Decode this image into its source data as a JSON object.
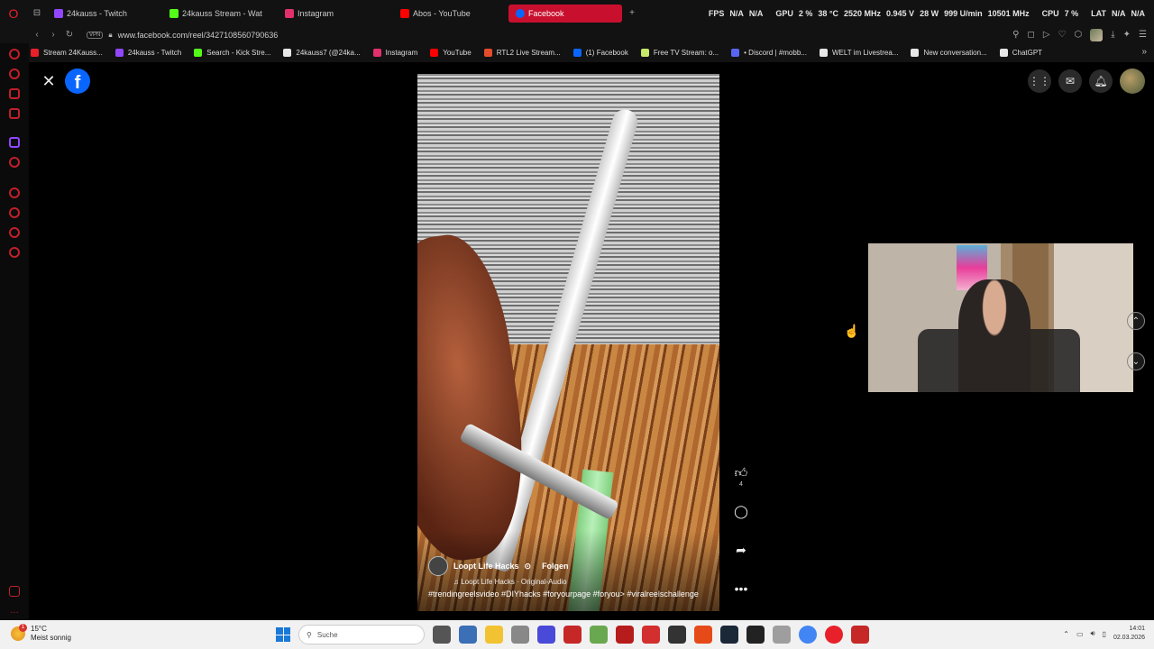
{
  "tabs": [
    {
      "label": "24kauss - Twitch",
      "color": "#9146ff"
    },
    {
      "label": "24kauss Stream - Wat",
      "color": "#53fc18"
    },
    {
      "label": "Instagram",
      "color": "#e1306c"
    },
    {
      "label": "Abos - YouTube",
      "color": "#ff0000"
    },
    {
      "label": "Facebook",
      "color": "#0866ff",
      "active": true
    }
  ],
  "stats": {
    "fps_label": "FPS",
    "fps_a": "N/A",
    "fps_b": "N/A",
    "gpu_label": "GPU",
    "gpu_pct": "2 %",
    "gpu_temp": "38 °C",
    "gpu_clock": "2520 MHz",
    "gpu_volt": "0.945 V",
    "gpu_watt": "28 W",
    "gpu_fan": "999 U/min",
    "gpu_mem": "10501 MHz",
    "cpu_label": "CPU",
    "cpu_pct": "7 %",
    "lat_label": "LAT",
    "lat_a": "N/A",
    "lat_b": "N/A"
  },
  "address": {
    "vpn": "VPN",
    "url": "www.facebook.com/reel/3427108560790636"
  },
  "bookmarks": [
    {
      "label": "Stream 24Kauss...",
      "color": "#e8202a"
    },
    {
      "label": "24kauss - Twitch",
      "color": "#9146ff"
    },
    {
      "label": "Search - Kick Stre...",
      "color": "#53fc18"
    },
    {
      "label": "24kauss7 (@24ka...",
      "color": "#e6e6e6"
    },
    {
      "label": "Instagram",
      "color": "#e1306c"
    },
    {
      "label": "YouTube",
      "color": "#ff0000"
    },
    {
      "label": "RTL2 Live Stream...",
      "color": "#e34d2b"
    },
    {
      "label": "(1) Facebook",
      "color": "#0866ff"
    },
    {
      "label": "Free TV Stream: o...",
      "color": "#c6e86b"
    },
    {
      "label": "• Discord | #mobb...",
      "color": "#5865f2"
    },
    {
      "label": "WELT im Livestrea...",
      "color": "#e6e6e6"
    },
    {
      "label": "New conversation...",
      "color": "#e6e6e6"
    },
    {
      "label": "ChatGPT",
      "color": "#e6e6e6"
    }
  ],
  "reel": {
    "author": "Loopt Life Hacks",
    "verified": "⊙",
    "follow": "Folgen",
    "audio": "♫ Loopt Life Hacks · Original-Audio",
    "tags": "#trendingreelsvideo #DIYhacks #foryourpage #foryou> #viralreelschallenge"
  },
  "actions": {
    "like_count": "4"
  },
  "taskbar": {
    "temp": "15°C",
    "weather": "Meist sonnig",
    "badge": "1",
    "search": "Suche",
    "time": "14:01",
    "date": "02.03.2026"
  }
}
